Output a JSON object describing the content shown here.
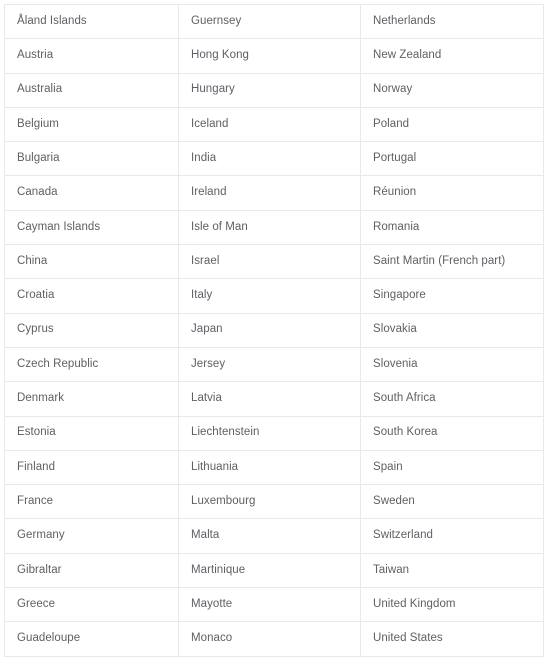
{
  "table": {
    "columns": 3,
    "row_count": 19,
    "border_color": "#e8e8ed",
    "text_color": "#5d6066",
    "background": "#ffffff",
    "rows": [
      [
        "Åland Islands",
        "Guernsey",
        "Netherlands"
      ],
      [
        "Austria",
        "Hong Kong",
        "New Zealand"
      ],
      [
        "Australia",
        "Hungary",
        "Norway"
      ],
      [
        "Belgium",
        "Iceland",
        "Poland"
      ],
      [
        "Bulgaria",
        "India",
        "Portugal"
      ],
      [
        "Canada",
        "Ireland",
        "Réunion"
      ],
      [
        "Cayman Islands",
        "Isle of Man",
        "Romania"
      ],
      [
        "China",
        "Israel",
        "Saint Martin (French part)"
      ],
      [
        "Croatia",
        "Italy",
        "Singapore"
      ],
      [
        "Cyprus",
        "Japan",
        "Slovakia"
      ],
      [
        "Czech Republic",
        "Jersey",
        "Slovenia"
      ],
      [
        "Denmark",
        "Latvia",
        "South Africa"
      ],
      [
        "Estonia",
        "Liechtenstein",
        "South Korea"
      ],
      [
        "Finland",
        "Lithuania",
        "Spain"
      ],
      [
        "France",
        "Luxembourg",
        "Sweden"
      ],
      [
        "Germany",
        "Malta",
        "Switzerland"
      ],
      [
        "Gibraltar",
        "Martinique",
        "Taiwan"
      ],
      [
        "Greece",
        "Mayotte",
        "United Kingdom"
      ],
      [
        "Guadeloupe",
        "Monaco",
        "United States"
      ]
    ]
  }
}
